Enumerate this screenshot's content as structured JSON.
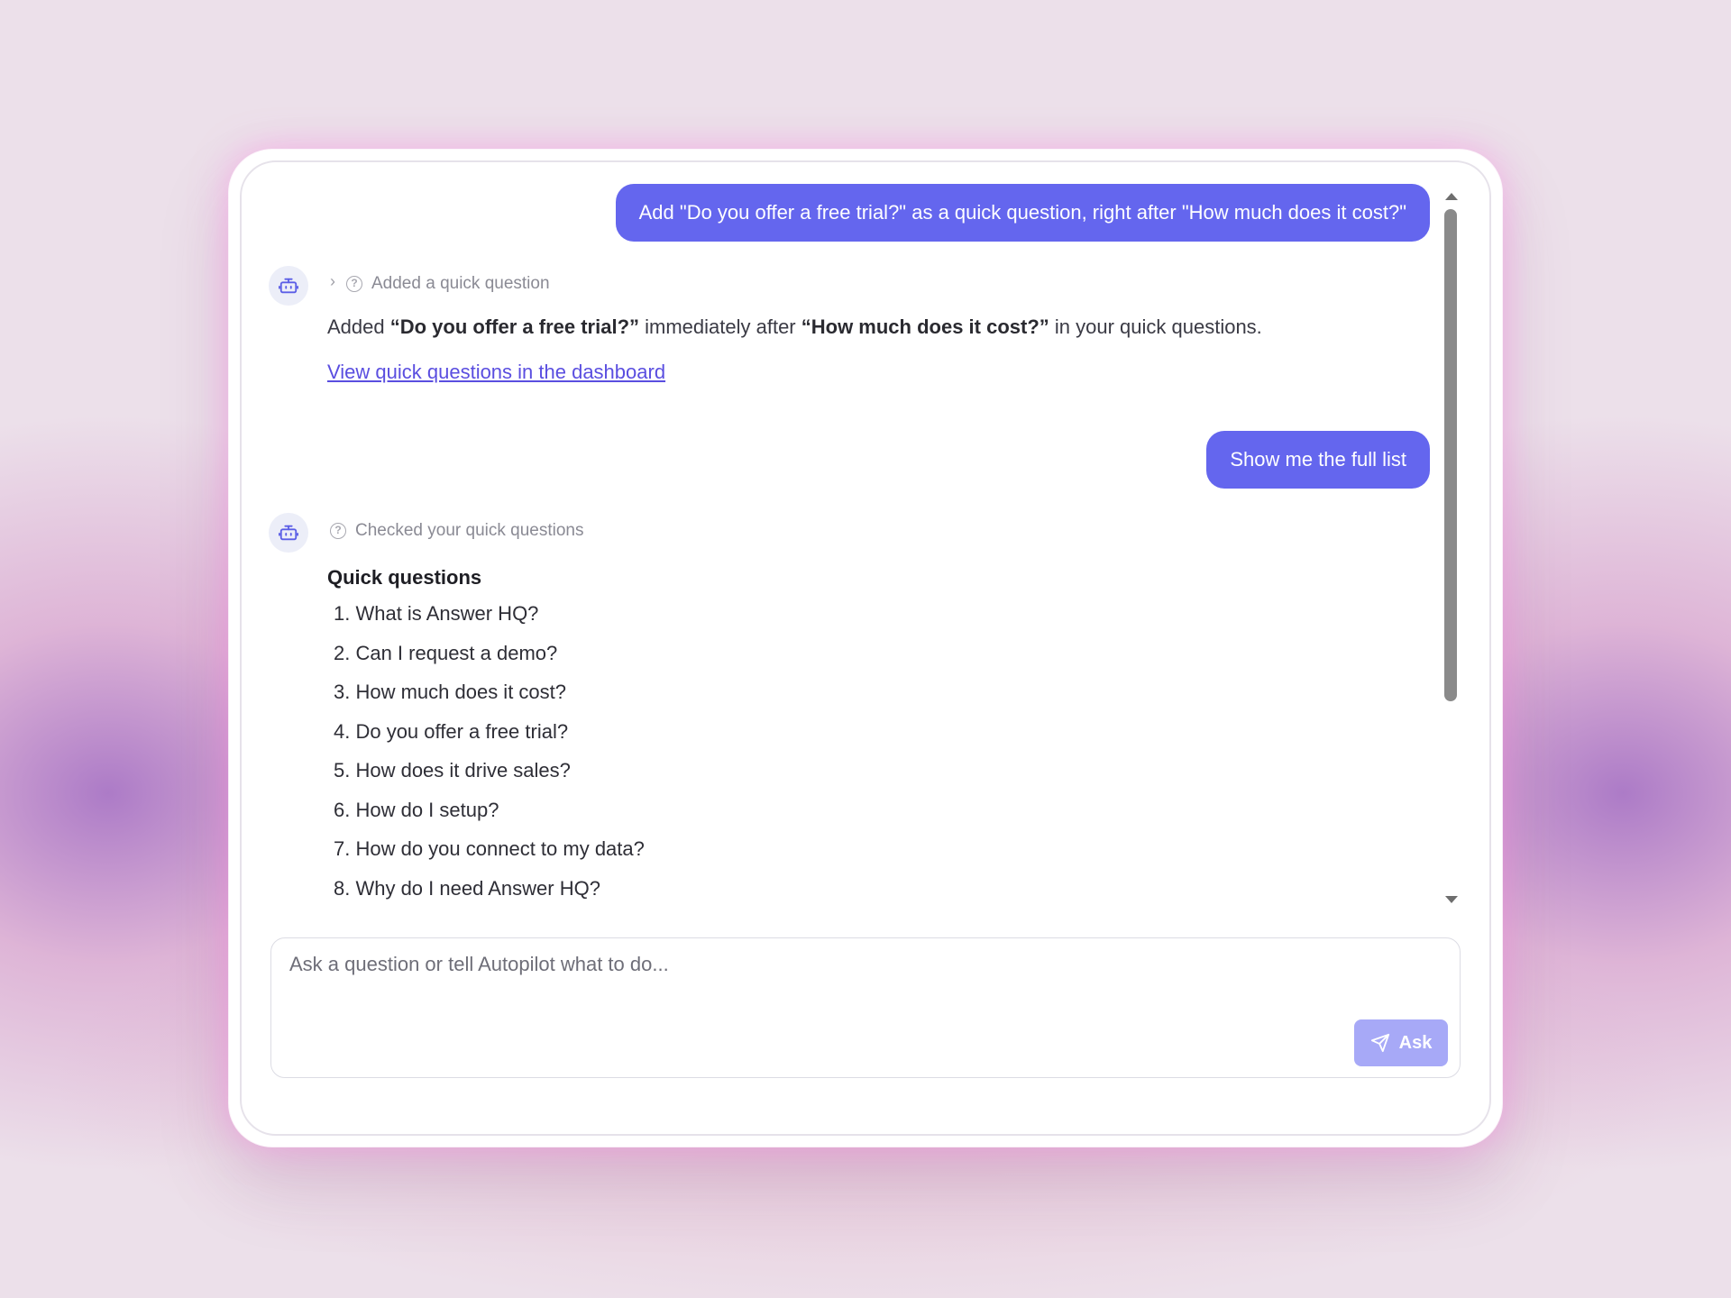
{
  "conversation": {
    "user_message_1": "Add \"Do you offer a free trial?\" as a quick question, right after \"How much does it cost?\"",
    "status_1": "Added a quick question",
    "reply_1": {
      "prefix": "Added ",
      "bold_1": "“Do you offer a free trial?”",
      "middle": " immediately after ",
      "bold_2": "“How much does it cost?”",
      "suffix": " in your quick questions."
    },
    "dashboard_link": "View quick questions in the dashboard",
    "user_message_2": "Show me the full list",
    "status_2": "Checked your quick questions",
    "list_title": "Quick questions",
    "quick_questions": [
      "1. What is Answer HQ?",
      "2. Can I request a demo?",
      "3. How much does it cost?",
      "4. Do you offer a free trial?",
      "5. How does it drive sales?",
      "6. How do I setup?",
      "7. How do you connect to my data?",
      "8. Why do I need Answer HQ?"
    ]
  },
  "composer": {
    "placeholder": "Ask a question or tell Autopilot what to do...",
    "ask_label": "Ask"
  },
  "icons": {
    "avatar": "robot-icon",
    "status": "question-circle-icon",
    "expand": "chevron-right-icon",
    "send": "send-icon"
  },
  "colors": {
    "accent": "#6466ee",
    "link": "#5a4ee0",
    "ask_button": "#a7a9f7"
  }
}
